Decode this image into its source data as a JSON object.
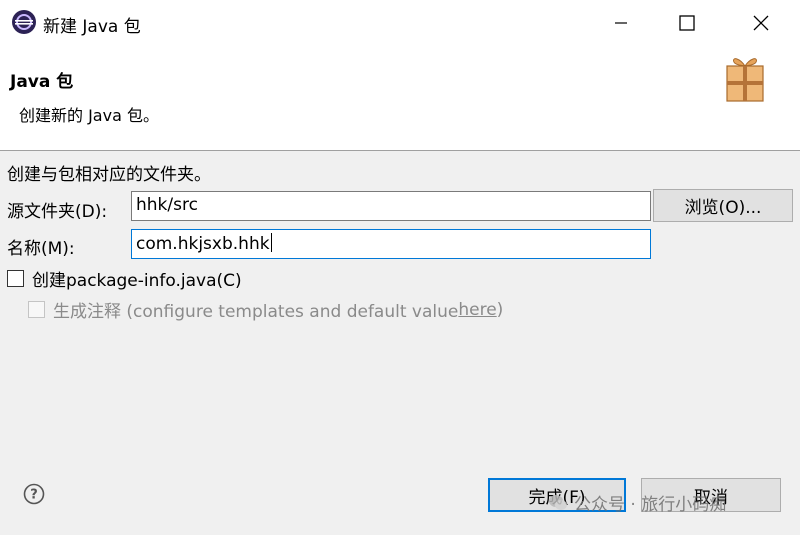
{
  "window": {
    "title": "新建 Java 包",
    "icons": {
      "app": "eclipse-icon",
      "minimize": "minimize-icon",
      "maximize": "maximize-icon",
      "close": "close-icon"
    }
  },
  "banner": {
    "title": "Java 包",
    "description": "创建新的 Java 包。",
    "icon": "package-gift-icon"
  },
  "form": {
    "instruction": "创建与包相对应的文件夹。",
    "source_folder": {
      "label": "源文件夹(D):",
      "value": "hhk/src",
      "browse_label": "浏览(O)..."
    },
    "name": {
      "label": "名称(M):",
      "value": "com.hkjsxb.hhk"
    },
    "create_package_info": {
      "label": "创建package-info.java(C)",
      "checked": false
    },
    "generate_comments": {
      "label_prefix": "生成注释 (configure templates and default value ",
      "link": "here",
      "label_suffix": ")",
      "checked": false,
      "enabled": false
    }
  },
  "footer": {
    "help_icon": "help-icon",
    "finish_label": "完成(F)",
    "cancel_label": "取消"
  },
  "watermark": {
    "text": "公众号 · 旅行小码痴",
    "icon": "wechat-icon"
  },
  "colors": {
    "accent": "#0078d7",
    "background": "#f0f0f0",
    "banner": "#ffffff"
  }
}
